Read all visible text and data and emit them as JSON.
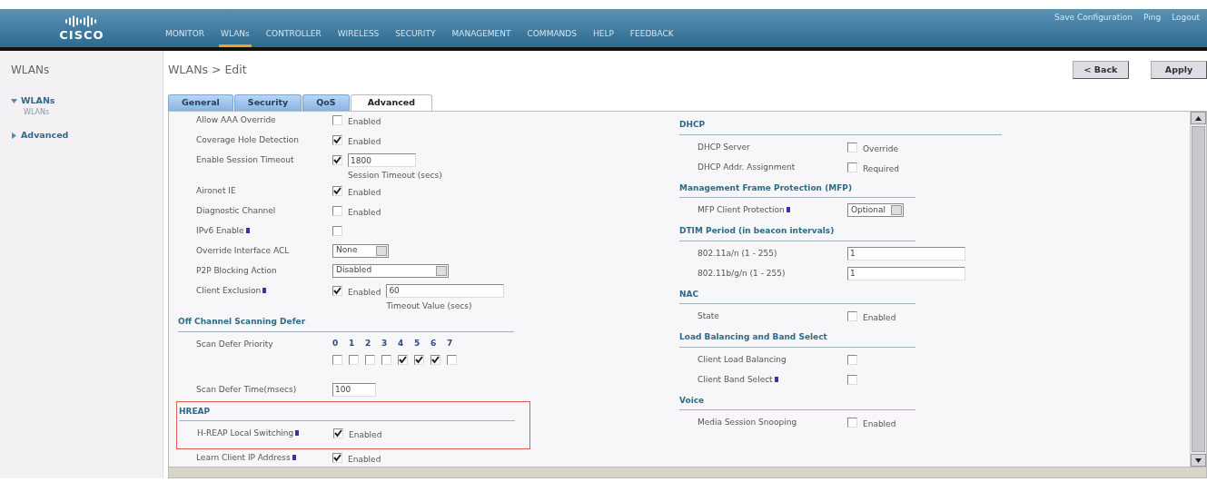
{
  "header": {
    "logo": "CISCO",
    "menu": [
      {
        "label": "MONITOR",
        "selected": false
      },
      {
        "label": "WLANs",
        "selected": true
      },
      {
        "label": "CONTROLLER",
        "selected": false
      },
      {
        "label": "WIRELESS",
        "selected": false
      },
      {
        "label": "SECURITY",
        "selected": false
      },
      {
        "label": "MANAGEMENT",
        "selected": false
      },
      {
        "label": "COMMANDS",
        "selected": false
      },
      {
        "label": "HELP",
        "selected": false
      },
      {
        "label": "FEEDBACK",
        "selected": false
      }
    ],
    "links": [
      "Save Configuration",
      "Ping",
      "Logout"
    ]
  },
  "sidebar": {
    "title": "WLANs",
    "items": [
      {
        "label": "WLANs",
        "expanded": true,
        "children": [
          {
            "label": "WLANs"
          }
        ]
      },
      {
        "label": "Advanced",
        "expanded": false
      }
    ]
  },
  "page_title": "WLANs > Edit",
  "buttons": [
    "< Back",
    "Apply"
  ],
  "tabs": [
    {
      "label": "General",
      "selected": false
    },
    {
      "label": "Security",
      "selected": false
    },
    {
      "label": "QoS",
      "selected": false
    },
    {
      "label": "Advanced",
      "selected": true
    }
  ],
  "left_sections": [
    {
      "rows": [
        {
          "kind": "checkbox",
          "label": "Allow AAA Override",
          "note": false,
          "checked": false,
          "option": "Enabled"
        },
        {
          "kind": "checkbox",
          "label": "Coverage Hole Detection",
          "note": false,
          "checked": true,
          "option": "Enabled"
        },
        {
          "kind": "checkinput",
          "label": "Enable Session Timeout",
          "note": false,
          "checked": true,
          "value": "1800",
          "caption": "Session Timeout (secs)"
        },
        {
          "kind": "checkbox",
          "label": "Aironet IE",
          "note": false,
          "checked": true,
          "option": "Enabled"
        },
        {
          "kind": "checkbox",
          "label": "Diagnostic Channel",
          "note": false,
          "checked": false,
          "option": "Enabled"
        },
        {
          "kind": "checkbox",
          "label": "IPv6 Enable",
          "note": true,
          "checked": false
        },
        {
          "kind": "select",
          "label": "Override Interface ACL",
          "note": false,
          "value": "None",
          "wide": false
        },
        {
          "kind": "select",
          "label": "P2P Blocking Action",
          "note": false,
          "value": "Disabled",
          "wide": true
        },
        {
          "kind": "checkinput",
          "label": "Client Exclusion",
          "note": true,
          "checked": true,
          "option": "Enabled",
          "value": "60",
          "caption": "Timeout Value (secs)"
        }
      ]
    },
    {
      "heading": "Off Channel Scanning Defer",
      "rows": [
        {
          "kind": "priority",
          "label": "Scan Defer Priority",
          "note": false,
          "options": [
            {
              "label": "0",
              "checked": false
            },
            {
              "label": "1",
              "checked": false
            },
            {
              "label": "2",
              "checked": false
            },
            {
              "label": "3",
              "checked": false
            },
            {
              "label": "4",
              "checked": true
            },
            {
              "label": "5",
              "checked": true
            },
            {
              "label": "6",
              "checked": true
            },
            {
              "label": "7",
              "checked": false
            }
          ]
        },
        {
          "kind": "input",
          "label": "Scan Defer Time(msecs)",
          "note": false,
          "value": "100"
        }
      ]
    },
    {
      "heading": "HREAP",
      "highlighted": true,
      "rows": [
        {
          "kind": "checkbox",
          "label": "H-REAP Local Switching",
          "note": true,
          "checked": true,
          "option": "Enabled"
        }
      ]
    },
    {
      "rows": [
        {
          "kind": "checkbox",
          "label": "Learn Client IP Address",
          "note": true,
          "checked": true,
          "option": "Enabled"
        }
      ]
    }
  ],
  "right_sections": [
    {
      "heading": "DHCP",
      "rows": [
        {
          "kind": "checkbox",
          "label": "DHCP Server",
          "note": false,
          "checked": false,
          "option": "Override"
        },
        {
          "kind": "checkbox",
          "label": "DHCP Addr. Assignment",
          "note": false,
          "checked": false,
          "option": "Required"
        }
      ]
    },
    {
      "heading": "Management Frame Protection (MFP)",
      "rows": [
        {
          "kind": "select",
          "label": "MFP Client Protection",
          "note": true,
          "value": "Optional",
          "wide": false
        }
      ]
    },
    {
      "heading": "DTIM Period (in beacon intervals)",
      "rows": [
        {
          "kind": "input",
          "label": "802.11a/n (1 - 255)",
          "note": false,
          "value": "1"
        },
        {
          "kind": "input",
          "label": "802.11b/g/n (1 - 255)",
          "note": false,
          "value": "1"
        }
      ]
    },
    {
      "heading": "NAC",
      "rows": [
        {
          "kind": "checkbox",
          "label": "State",
          "note": false,
          "checked": false,
          "option": "Enabled"
        }
      ]
    },
    {
      "heading": "Load Balancing and Band Select",
      "rows": [
        {
          "kind": "checkbox",
          "label": "Client Load Balancing",
          "note": false,
          "checked": false
        },
        {
          "kind": "checkbox",
          "label": "Client Band Select",
          "note": true,
          "checked": false
        }
      ]
    },
    {
      "heading": "Voice",
      "rows": [
        {
          "kind": "checkbox",
          "label": "Media Session Snooping",
          "note": false,
          "checked": false,
          "option": "Enabled"
        }
      ]
    }
  ]
}
